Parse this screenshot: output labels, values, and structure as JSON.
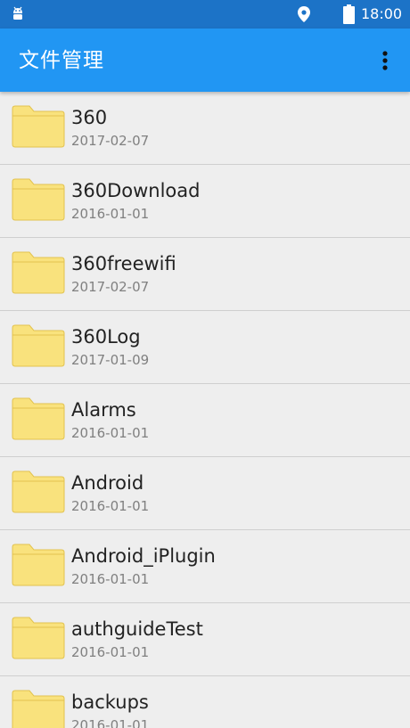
{
  "status_bar": {
    "time": "18:00",
    "icons": [
      "android-debug-icon",
      "location-icon",
      "battery-icon"
    ]
  },
  "app_bar": {
    "title": "文件管理",
    "menu_icon": "more-vertical-icon"
  },
  "colors": {
    "status_bar": "#1c73c7",
    "app_bar": "#2196f3",
    "background": "#eeeeee",
    "folder": "#f9e27d",
    "folder_edge": "#e2c24e"
  },
  "files": [
    {
      "name": "360",
      "date": "2017-02-07",
      "icon": "folder-icon"
    },
    {
      "name": "360Download",
      "date": "2016-01-01",
      "icon": "folder-icon"
    },
    {
      "name": "360freewifi",
      "date": "2017-02-07",
      "icon": "folder-icon"
    },
    {
      "name": "360Log",
      "date": "2017-01-09",
      "icon": "folder-icon"
    },
    {
      "name": "Alarms",
      "date": "2016-01-01",
      "icon": "folder-icon"
    },
    {
      "name": "Android",
      "date": "2016-01-01",
      "icon": "folder-icon"
    },
    {
      "name": "Android_iPlugin",
      "date": "2016-01-01",
      "icon": "folder-icon"
    },
    {
      "name": "authguideTest",
      "date": "2016-01-01",
      "icon": "folder-icon"
    },
    {
      "name": "backups",
      "date": "2016-01-01",
      "icon": "folder-icon"
    }
  ]
}
